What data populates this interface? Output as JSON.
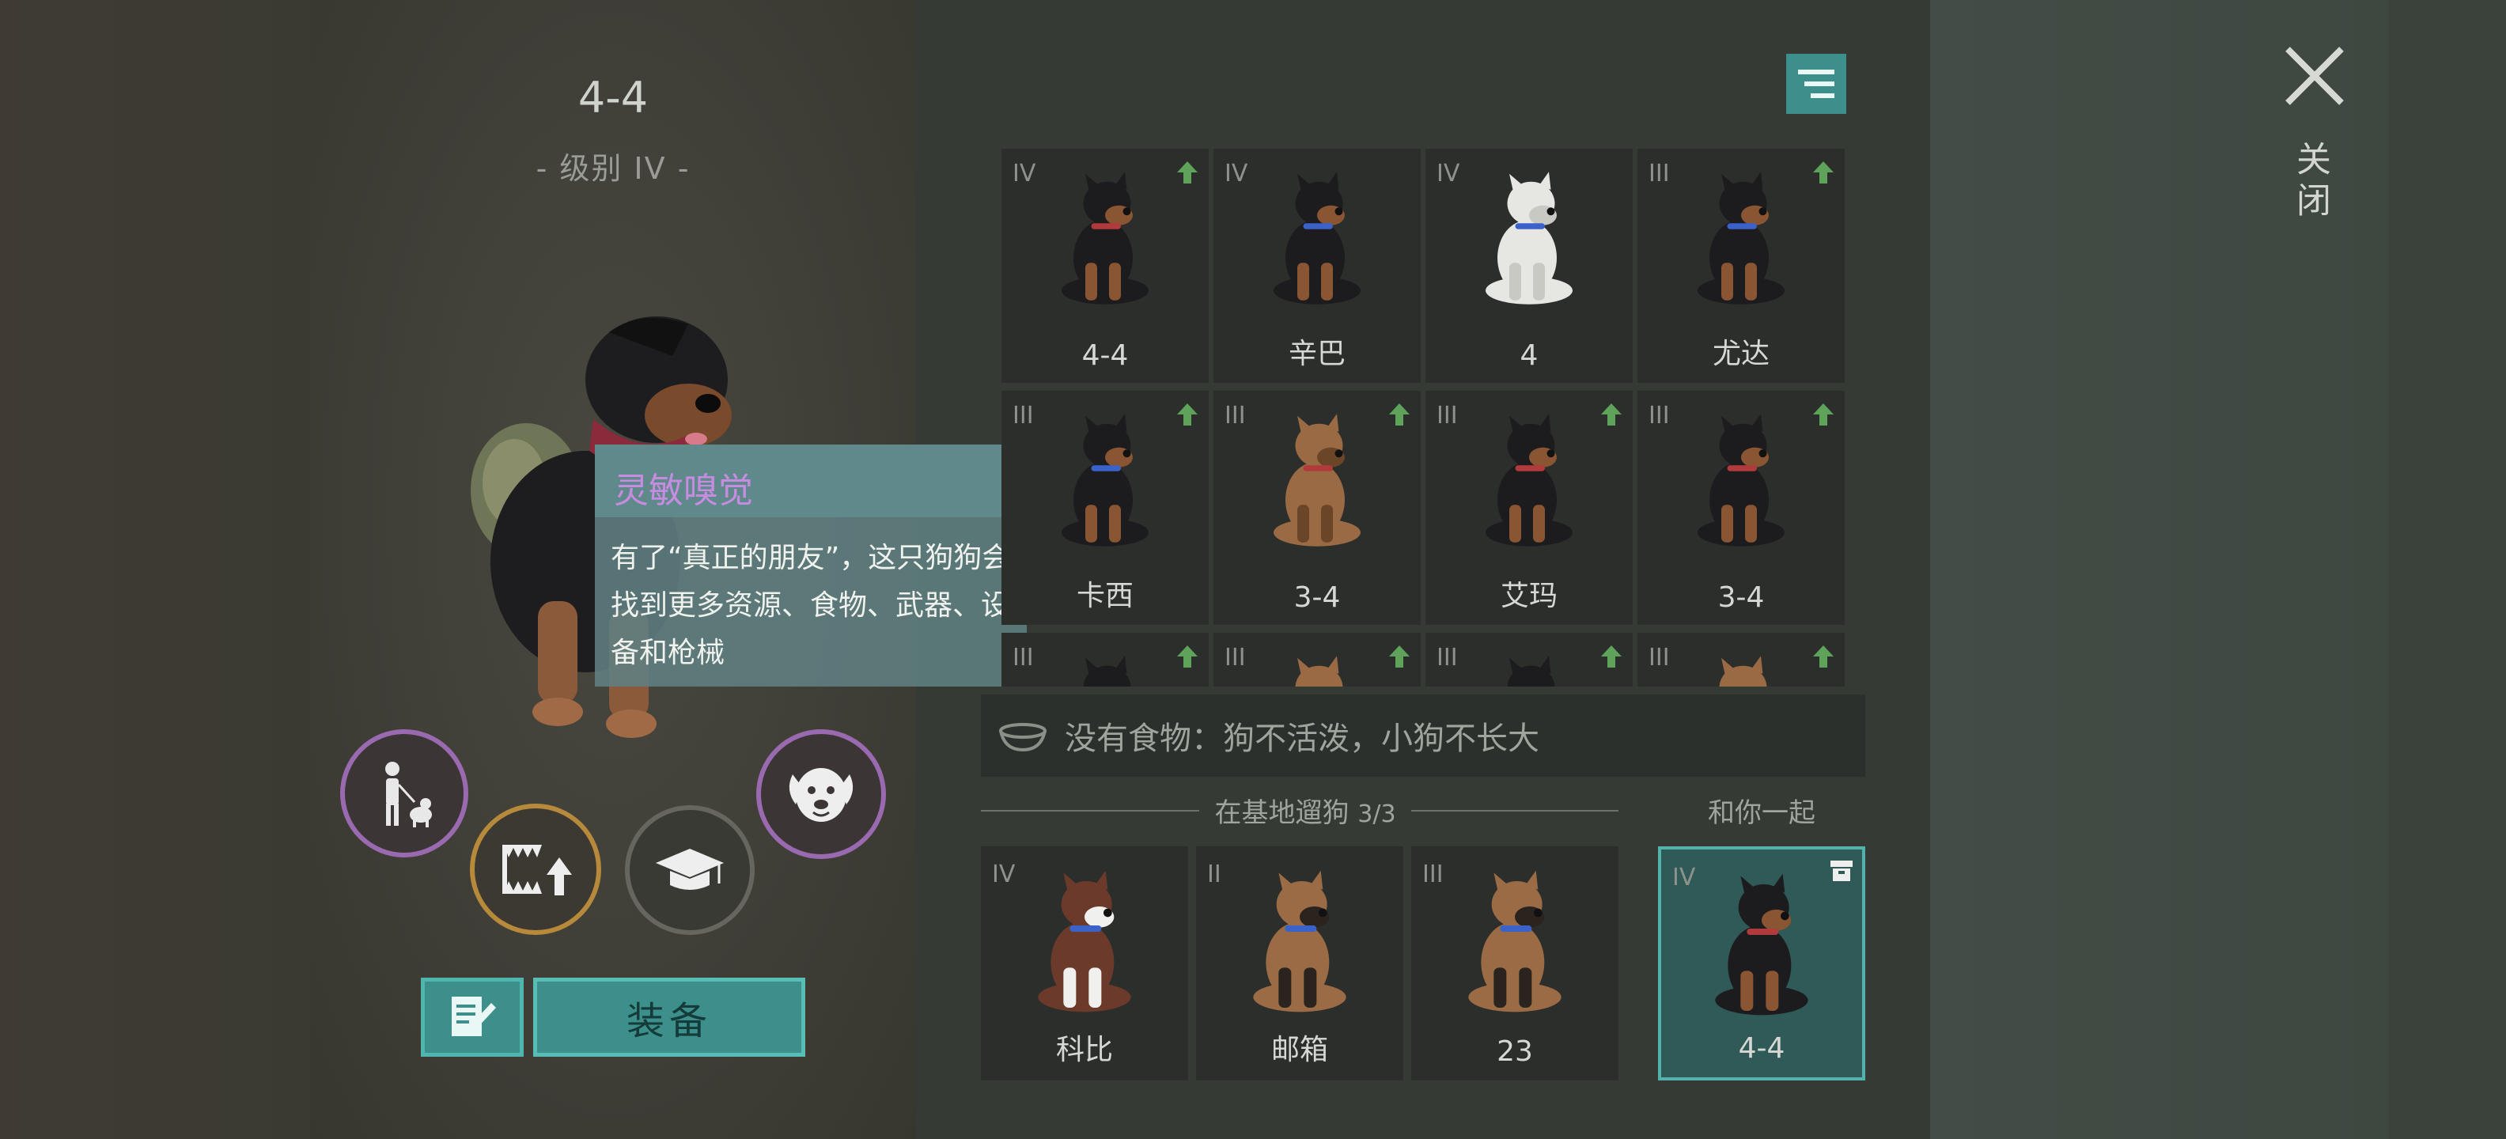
{
  "selected_dog": {
    "name": "4-4",
    "level": "- 级别 IV -"
  },
  "tooltip": {
    "title": "灵敏嗅觉",
    "body": "有了“真正的朋友”，这只狗狗会找到更多资源、食物、武器、设备和枪械"
  },
  "actions": {
    "equip_label": "装备"
  },
  "dog_grid": [
    {
      "tier": "IV",
      "name": "4-4",
      "upgrade": true,
      "coat": "rott",
      "collar": "#b13a3a"
    },
    {
      "tier": "IV",
      "name": "辛巴",
      "upgrade": false,
      "coat": "rott",
      "collar": "#3a62c8"
    },
    {
      "tier": "IV",
      "name": "4",
      "upgrade": false,
      "coat": "white",
      "collar": "#3a62c8"
    },
    {
      "tier": "III",
      "name": "尤达",
      "upgrade": true,
      "coat": "rott",
      "collar": "#3a62c8"
    },
    {
      "tier": "III",
      "name": "卡西",
      "upgrade": true,
      "coat": "rott",
      "collar": "#3a62c8"
    },
    {
      "tier": "III",
      "name": "3-4",
      "upgrade": true,
      "coat": "tan",
      "collar": "#b13a3a"
    },
    {
      "tier": "III",
      "name": "艾玛",
      "upgrade": true,
      "coat": "rott",
      "collar": "#b13a3a"
    },
    {
      "tier": "III",
      "name": "3-4",
      "upgrade": true,
      "coat": "rott",
      "collar": "#b13a3a"
    },
    {
      "tier": "III",
      "name": "",
      "upgrade": true,
      "coat": "rott",
      "collar": "#b13a3a"
    },
    {
      "tier": "III",
      "name": "",
      "upgrade": true,
      "coat": "tan",
      "collar": "#b13a3a"
    },
    {
      "tier": "III",
      "name": "",
      "upgrade": true,
      "coat": "rott",
      "collar": "#b13a3a"
    },
    {
      "tier": "III",
      "name": "",
      "upgrade": true,
      "coat": "tan",
      "collar": "#b13a3a"
    }
  ],
  "food_status": "没有食物：狗不活泼，小狗不长大",
  "walking": {
    "label": "在基地遛狗",
    "count": "3/3",
    "dogs": [
      {
        "tier": "IV",
        "name": "科比",
        "coat": "husky",
        "collar": "#3a62c8"
      },
      {
        "tier": "II",
        "name": "邮箱",
        "coat": "shepherd",
        "collar": "#3a62c8"
      },
      {
        "tier": "III",
        "name": "23",
        "coat": "shepherd",
        "collar": "#3a62c8"
      }
    ]
  },
  "with_you": {
    "label": "和你一起",
    "dog": {
      "tier": "IV",
      "name": "4-4",
      "coat": "rott",
      "collar": "#b13a3a"
    }
  },
  "close_label": "关闭",
  "colors": {
    "accent_teal": "#3c8f8b",
    "upgrade_green": "#5fa35a",
    "tooltip_title": "#c58ce0",
    "perk_purple": "#9a6ab0",
    "perk_gold": "#b7893b"
  },
  "icons": {
    "filter": "filter-icon",
    "close": "close-icon",
    "food_bowl": "food-bowl-icon",
    "walk": "person-with-dog-icon",
    "teeth_upgrade": "teeth-upgrade-icon",
    "training": "graduation-cap-icon",
    "dog_face": "dog-face-icon",
    "notes": "notes-edit-icon",
    "upgrade": "upgrade-arrow-icon",
    "storage": "storage-box-icon"
  }
}
